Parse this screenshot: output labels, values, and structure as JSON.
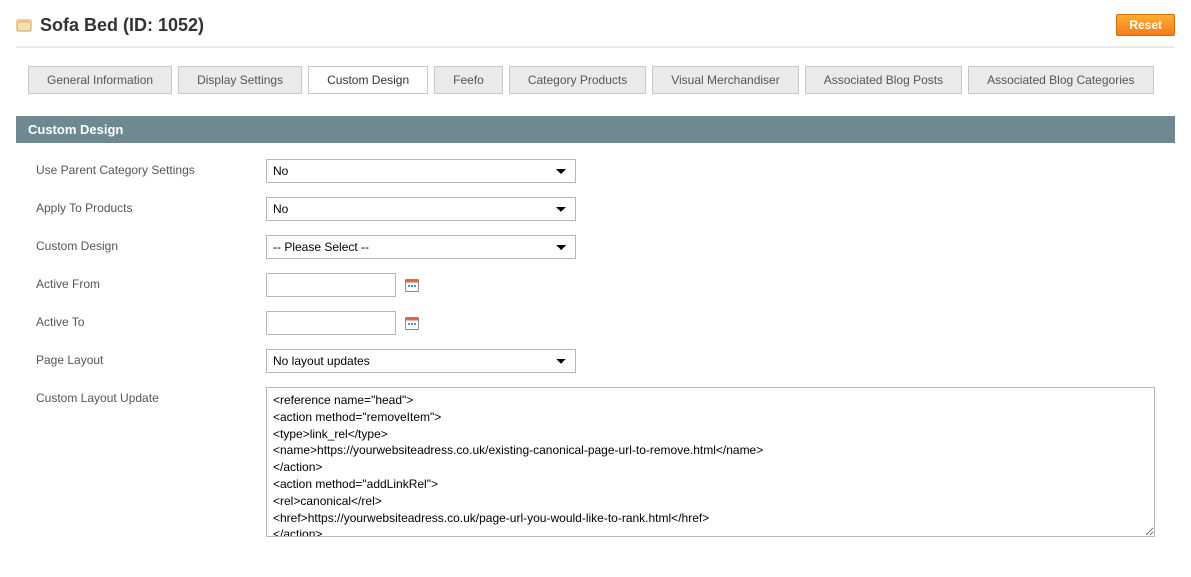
{
  "header": {
    "title": "Sofa Bed (ID: 1052)",
    "reset_label": "Reset"
  },
  "tabs": [
    {
      "label": "General Information"
    },
    {
      "label": "Display Settings"
    },
    {
      "label": "Custom Design"
    },
    {
      "label": "Feefo"
    },
    {
      "label": "Category Products"
    },
    {
      "label": "Visual Merchandiser"
    },
    {
      "label": "Associated Blog Posts"
    },
    {
      "label": "Associated Blog Categories"
    }
  ],
  "section": {
    "title": "Custom Design",
    "fields": {
      "use_parent_label": "Use Parent Category Settings",
      "use_parent_value": "No",
      "apply_to_products_label": "Apply To Products",
      "apply_to_products_value": "No",
      "custom_design_label": "Custom Design",
      "custom_design_value": "-- Please Select --",
      "active_from_label": "Active From",
      "active_from_value": "",
      "active_to_label": "Active To",
      "active_to_value": "",
      "page_layout_label": "Page Layout",
      "page_layout_value": "No layout updates",
      "custom_layout_update_label": "Custom Layout Update",
      "custom_layout_update_value": "<reference name=\"head\">\n<action method=\"removeItem\">\n<type>link_rel</type>\n<name>https://yourwebsiteadress.co.uk/existing-canonical-page-url-to-remove.html</name>\n</action>\n<action method=\"addLinkRel\">\n<rel>canonical</rel>\n<href>https://yourwebsiteadress.co.uk/page-url-you-would-like-to-rank.html</href>\n</action>\n</reference>"
    }
  }
}
